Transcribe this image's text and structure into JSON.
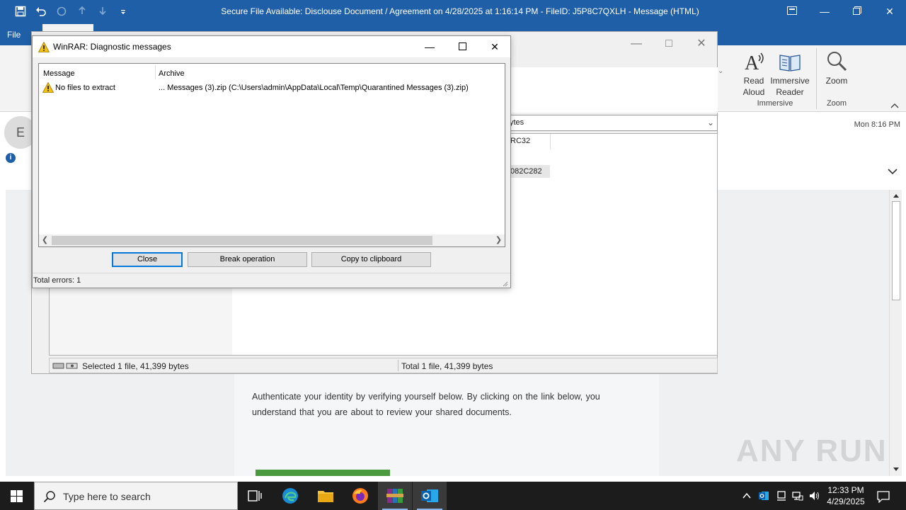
{
  "outlook": {
    "title": "Secure File Available: Disclouse Document / Agreement on 4/28/2025 at 1:16:14 PM - FileID: J5P8C7QXLH  -  Message (HTML)",
    "file_tab": "File",
    "ribbon": {
      "read_aloud": [
        "Read",
        "Aloud"
      ],
      "immersive_reader": [
        "Immersive",
        "Reader"
      ],
      "immersive_group": "Immersive",
      "zoom": "Zoom",
      "zoom_group": "Zoom"
    },
    "sender_initial": "E",
    "time": "Mon 8:16 PM",
    "email_body": "Authenticate your identity by verifying yourself below. By clicking on the link below, you understand that you are about to review your shared documents."
  },
  "winrar_main": {
    "path_fragment": "ytes",
    "crc_header": "RC32",
    "crc_value": "082C282",
    "status_selected": "Selected 1 file, 41,399 bytes",
    "status_total": "Total 1 file, 41,399 bytes"
  },
  "diagnostic": {
    "title": "WinRAR: Diagnostic messages",
    "col_message": "Message",
    "col_archive": "Archive",
    "rows": [
      {
        "message": "No files to extract",
        "archive": "... Messages (3).zip (C:\\Users\\admin\\AppData\\Local\\Temp\\Quarantined Messages (3).zip)"
      }
    ],
    "btn_close": "Close",
    "btn_break": "Break operation",
    "btn_copy": "Copy to clipboard",
    "status": "Total errors: 1"
  },
  "watermark": "ANY RUN",
  "taskbar": {
    "search_placeholder": "Type here to search",
    "time": "12:33 PM",
    "date": "4/29/2025"
  },
  "colors": {
    "outlook_blue": "#1f5fa8",
    "accent_focus": "#0078d7",
    "email_button_green": "#4c9a40"
  }
}
